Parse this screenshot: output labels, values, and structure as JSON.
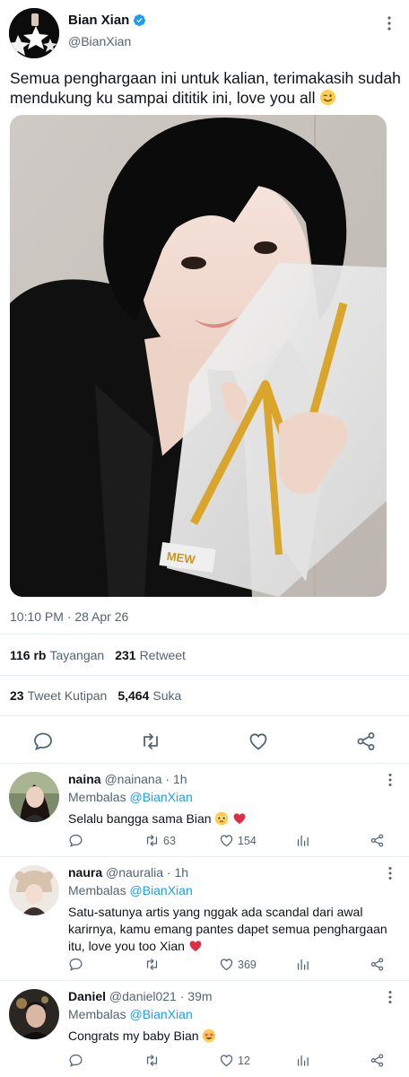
{
  "tweet": {
    "author_name": "Bian Xian",
    "author_handle": "@BianXian",
    "text": "Semua penghargaan ini untuk kalian, terimakasih sudah mendukung ku sampai dititik ini, love you all",
    "text_emoji": "winking-face-emoji",
    "timestamp": "10:10 PM · 28 Apr 26",
    "views_count": "116 rb",
    "views_label": "Tayangan",
    "retweets_count": "231",
    "retweets_label": "Retweet",
    "quotes_count": "23",
    "quotes_label": "Tweet Kutipan",
    "likes_count": "5,464",
    "likes_label": "Suka",
    "photo_trophy_text": "MEW"
  },
  "actions": [
    "reply-icon",
    "retweet-icon",
    "like-icon",
    "share-icon"
  ],
  "replies": [
    {
      "name": "naina",
      "handle": "@nainana",
      "time": "1h",
      "replying_prefix": "Membalas",
      "replying_to": "@BianXian",
      "text": "Selalu bangga sama Bian",
      "emojis": [
        "pleading-face-emoji",
        "red-heart-emoji"
      ],
      "retweets": "63",
      "likes": "154"
    },
    {
      "name": "naura",
      "handle": "@nauralia",
      "time": "1h",
      "replying_prefix": "Membalas",
      "replying_to": "@BianXian",
      "text": "Satu-satunya artis yang nggak ada scandal dari awal karirnya, kamu emang pantes dapet semua penghargaan itu, love you too Xian",
      "emojis": [
        "red-heart-emoji"
      ],
      "retweets": "",
      "likes": "369"
    },
    {
      "name": "Daniel",
      "handle": "@daniel021",
      "time": "39m",
      "replying_prefix": "Membalas",
      "replying_to": "@BianXian",
      "text": "Congrats my baby Bian",
      "emojis": [
        "star-struck-emoji"
      ],
      "retweets": "",
      "likes": "12"
    }
  ],
  "colors": {
    "accent": "#1d9bf0",
    "secondary_text": "#536471",
    "divider": "#e6ecf0",
    "heart_red": "#e0245e"
  }
}
